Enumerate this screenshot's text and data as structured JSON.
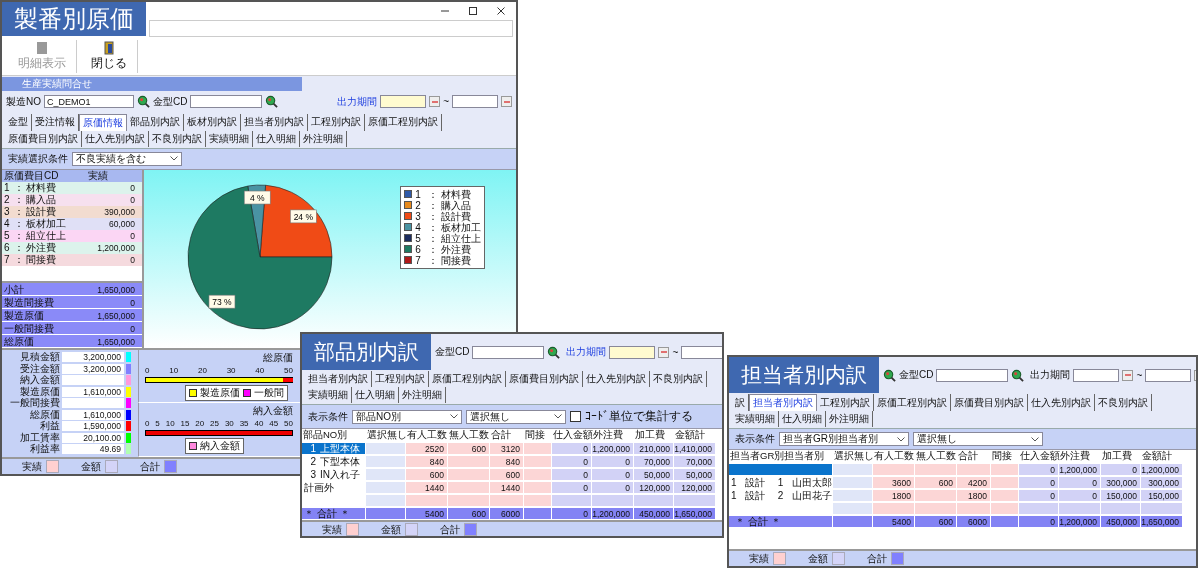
{
  "main_window": {
    "banner": "製番別原価",
    "toolbar": [
      {
        "kind": "details",
        "label": "明細表示",
        "disabled": true
      },
      {
        "kind": "close",
        "label": "閉じる",
        "disabled": false
      }
    ],
    "section_title": "生産実績問合せ",
    "fields": {
      "order_no_label": "製造NO",
      "order_no_value": "C_DEMO1",
      "mold_label": "金型CD",
      "period_label": "出力期間",
      "period_highlighted": true,
      "period_separator": "~"
    },
    "tabs": [
      {
        "label": "金型",
        "selected": false
      },
      {
        "label": "受注情報",
        "selected": false
      },
      {
        "label": "原価情報",
        "selected": true
      },
      {
        "label": "部品別内訳",
        "selected": false
      },
      {
        "label": "板材別内訳",
        "selected": false
      },
      {
        "label": "担当者別内訳",
        "selected": false
      },
      {
        "label": "工程別内訳",
        "selected": false
      },
      {
        "label": "原価工程別内訳",
        "selected": false
      },
      {
        "label": "原価費目別内訳",
        "selected": false
      },
      {
        "label": "仕入先別内訳",
        "selected": false
      },
      {
        "label": "不良別内訳",
        "selected": false
      },
      {
        "label": "実績明細",
        "selected": false
      },
      {
        "label": "仕入明細",
        "selected": false
      },
      {
        "label": "外注明細",
        "selected": false
      }
    ],
    "condition": {
      "label": "実績選択条件",
      "value": "不良実績を含む"
    },
    "cost_table": {
      "columns": [
        "原価費目CD",
        "実績"
      ],
      "separator": "：",
      "rows": [
        {
          "code": "1",
          "name": "材料費",
          "value": "0",
          "color": "#dcf3ec"
        },
        {
          "code": "2",
          "name": "購入品",
          "value": "0",
          "color": "#f6e0ef"
        },
        {
          "code": "3",
          "name": "設計費",
          "value": "390,000",
          "color": "#f2dcd0"
        },
        {
          "code": "4",
          "name": "板材加工",
          "value": "60,000",
          "color": "#e0e0f6"
        },
        {
          "code": "5",
          "name": "組立仕上",
          "value": "0",
          "color": "#fbd6f4"
        },
        {
          "code": "6",
          "name": "外注費",
          "value": "1,200,000",
          "color": "#dcf3ec"
        },
        {
          "code": "7",
          "name": "間接費",
          "value": "0",
          "color": "#f5dade"
        }
      ],
      "summary": [
        {
          "label": "小計",
          "value": "1,650,000"
        },
        {
          "label": "製造間接費",
          "value": "0"
        },
        {
          "label": "製造原価",
          "value": "1,650,000"
        },
        {
          "label": "一般間接費",
          "value": "0"
        },
        {
          "label": "総原価",
          "value": "1,650,000"
        }
      ]
    },
    "pie_panel": {
      "chart_data": {
        "type": "pie",
        "categories": [
          "材料費",
          "購入品",
          "設計費",
          "板材加工",
          "組立仕上",
          "外注費",
          "間接費"
        ],
        "values": [
          0,
          0,
          24,
          4,
          0,
          73,
          0
        ],
        "value_labels": [
          null,
          null,
          "24 %",
          "4 %",
          null,
          "73 %",
          null
        ]
      },
      "separator": "：",
      "legend": [
        {
          "code": "1",
          "color": "#2f5aa8"
        },
        {
          "code": "2",
          "color": "#e88a1c"
        },
        {
          "code": "3",
          "color": "#f04b16"
        },
        {
          "code": "4",
          "color": "#4a93a3"
        },
        {
          "code": "5",
          "color": "#1c2c5e"
        },
        {
          "code": "6",
          "color": "#1e7a62"
        },
        {
          "code": "7",
          "color": "#b01818"
        }
      ]
    },
    "amounts": [
      {
        "label": "見積金額",
        "value": "3,200,000",
        "color": "#00ffff"
      },
      {
        "label": "受注金額",
        "value": "3,200,000",
        "color": "#8080ff"
      },
      {
        "label": "納入金額",
        "color": "#ff99dd"
      },
      {
        "label": "製造原価",
        "value": "1,610,000",
        "color": "#ffff00"
      },
      {
        "label": "一般間接費",
        "color": "#ff00ff"
      },
      {
        "label": "総原価",
        "value": "1,610,000",
        "color": "#0000ff"
      },
      {
        "label": "利益",
        "value": "1,590,000",
        "color": "#ff0000"
      },
      {
        "label": "加工賃率",
        "value": "20,100.00",
        "color": "#00ff00"
      },
      {
        "label": "利益率",
        "value": "49.69",
        "color": "#b0ffb0"
      }
    ],
    "bar_charts": [
      {
        "kind": "cost",
        "title": "総原価",
        "ticks": [
          "0",
          "10",
          "20",
          "30",
          "40",
          "50"
        ],
        "legend": [
          {
            "label": "製造原価",
            "color": "#ffff00"
          },
          {
            "label": "一般間",
            "color": "#ff00ff"
          }
        ]
      },
      {
        "kind": "delivery",
        "title": "納入金額",
        "ticks": [
          "0",
          "5",
          "10",
          "15",
          "20",
          "25",
          "30",
          "35",
          "40",
          "45",
          "50"
        ],
        "legend": [
          {
            "label": "納入金額",
            "color": "#ff88dd"
          }
        ]
      }
    ],
    "status_legend": [
      {
        "label": "実績",
        "color": "#ffd0d0"
      },
      {
        "label": "金額",
        "color": "#d4d4f8"
      },
      {
        "label": "合計",
        "color": "#8080ff"
      }
    ]
  },
  "parts_window": {
    "banner": "部品別内訳",
    "fields": {
      "mold_label": "金型CD",
      "period_label": "出力期間",
      "period_highlighted": true,
      "period_separator": "~"
    },
    "tabs": [
      {
        "label": "担当者別内訳",
        "selected": false
      },
      {
        "label": "工程別内訳",
        "selected": false
      },
      {
        "label": "原価工程別内訳",
        "selected": false
      },
      {
        "label": "原価費目別内訳",
        "selected": false
      },
      {
        "label": "仕入先別内訳",
        "selected": false
      },
      {
        "label": "不良別内訳",
        "selected": false
      },
      {
        "label": "実績明細",
        "selected": false
      },
      {
        "label": "仕入明細",
        "selected": false
      },
      {
        "label": "外注明細",
        "selected": false
      }
    ],
    "condition": {
      "label": "表示条件",
      "selects": [
        "部品NO別",
        "選択無し"
      ],
      "checkbox": {
        "label": "ｺｰﾄﾞ単位で集計する",
        "checked": false
      }
    },
    "table": {
      "columns": [
        "部品NO別",
        "選択無し",
        "有人工数",
        "無人工数",
        "合計",
        "間接",
        "仕入金額",
        "外注費",
        "加工費",
        "金額計"
      ],
      "rows": [
        {
          "kind": "item",
          "selected": true,
          "lead": [
            "1",
            "上型本体"
          ],
          "values": {
            "manned": "2520",
            "unmanned": "600",
            "subtotal": "3120",
            "purchase": "0",
            "outsource": "1,200,000",
            "processing": "210,000",
            "amount": "1,410,000"
          }
        },
        {
          "kind": "item",
          "selected": false,
          "lead": [
            "2",
            "下型本体"
          ],
          "values": {
            "manned": "840",
            "subtotal": "840",
            "purchase": "0",
            "outsource": "0",
            "processing": "70,000",
            "amount": "70,000"
          }
        },
        {
          "kind": "item",
          "selected": false,
          "lead": [
            "3",
            "IN入れ子"
          ],
          "values": {
            "manned": "600",
            "subtotal": "600",
            "purchase": "0",
            "outsource": "0",
            "processing": "50,000",
            "amount": "50,000"
          }
        },
        {
          "kind": "item",
          "selected": false,
          "lead": [
            "計画外"
          ],
          "values": {
            "manned": "1440",
            "subtotal": "1440",
            "purchase": "0",
            "outsource": "0",
            "processing": "120,000",
            "amount": "120,000"
          }
        },
        {
          "kind": "blank"
        },
        {
          "kind": "total",
          "selected": false,
          "lead": [
            "＊ 合計 ＊"
          ],
          "values": {
            "manned": "5400",
            "unmanned": "600",
            "subtotal": "6000",
            "purchase": "0",
            "outsource": "1,200,000",
            "processing": "450,000",
            "amount": "1,650,000"
          }
        }
      ]
    },
    "status_legend": [
      {
        "label": "実績",
        "color": "#ffd0d0"
      },
      {
        "label": "金額",
        "color": "#d4d4f8"
      },
      {
        "label": "合計",
        "color": "#8080ff"
      }
    ]
  },
  "staff_window": {
    "banner": "担当者別内訳",
    "fields": {
      "order_no_search": true,
      "mold_label": "金型CD",
      "period_label": "出力期間",
      "period_highlighted": false,
      "period_separator": "~"
    },
    "tabs": [
      {
        "label": "訳",
        "selected": false
      },
      {
        "label": "担当者別内訳",
        "selected": true
      },
      {
        "label": "工程別内訳",
        "selected": false
      },
      {
        "label": "原価工程別内訳",
        "selected": false
      },
      {
        "label": "原価費目別内訳",
        "selected": false
      },
      {
        "label": "仕入先別内訳",
        "selected": false
      },
      {
        "label": "不良別内訳",
        "selected": false
      },
      {
        "label": "実績明細",
        "selected": false
      },
      {
        "label": "仕入明細",
        "selected": false
      },
      {
        "label": "外注明細",
        "selected": false
      }
    ],
    "condition": {
      "label": "表示条件",
      "selects": [
        "担当者GR別担当者別",
        "選択無し"
      ]
    },
    "table": {
      "columns": [
        "担当者GR別担当者別",
        "選択無し",
        "有人工数",
        "無人工数",
        "合計",
        "間接",
        "仕入金額",
        "外注費",
        "加工費",
        "金額計"
      ],
      "rows": [
        {
          "kind": "item",
          "selected": true,
          "lead": [],
          "values": {
            "purchase": "0",
            "outsource": "1,200,000",
            "processing": "0",
            "amount": "1,200,000"
          }
        },
        {
          "kind": "item",
          "selected": false,
          "lead": [
            "1",
            "設計",
            "1",
            "山田太郎"
          ],
          "values": {
            "manned": "3600",
            "unmanned": "600",
            "subtotal": "4200",
            "purchase": "0",
            "outsource": "0",
            "processing": "300,000",
            "amount": "300,000"
          }
        },
        {
          "kind": "item",
          "selected": false,
          "lead": [
            "1",
            "設計",
            "2",
            "山田花子"
          ],
          "values": {
            "manned": "1800",
            "subtotal": "1800",
            "purchase": "0",
            "outsource": "0",
            "processing": "150,000",
            "amount": "150,000"
          }
        },
        {
          "kind": "blank"
        },
        {
          "kind": "total",
          "selected": false,
          "lead": [
            "＊ 合計 ＊"
          ],
          "values": {
            "manned": "5400",
            "unmanned": "600",
            "subtotal": "6000",
            "purchase": "0",
            "outsource": "1,200,000",
            "processing": "450,000",
            "amount": "1,650,000"
          }
        }
      ]
    },
    "status_legend": [
      {
        "label": "実績",
        "color": "#ffd0d0"
      },
      {
        "label": "金額",
        "color": "#d4d4f8"
      },
      {
        "label": "合計",
        "color": "#8080ff"
      }
    ]
  }
}
